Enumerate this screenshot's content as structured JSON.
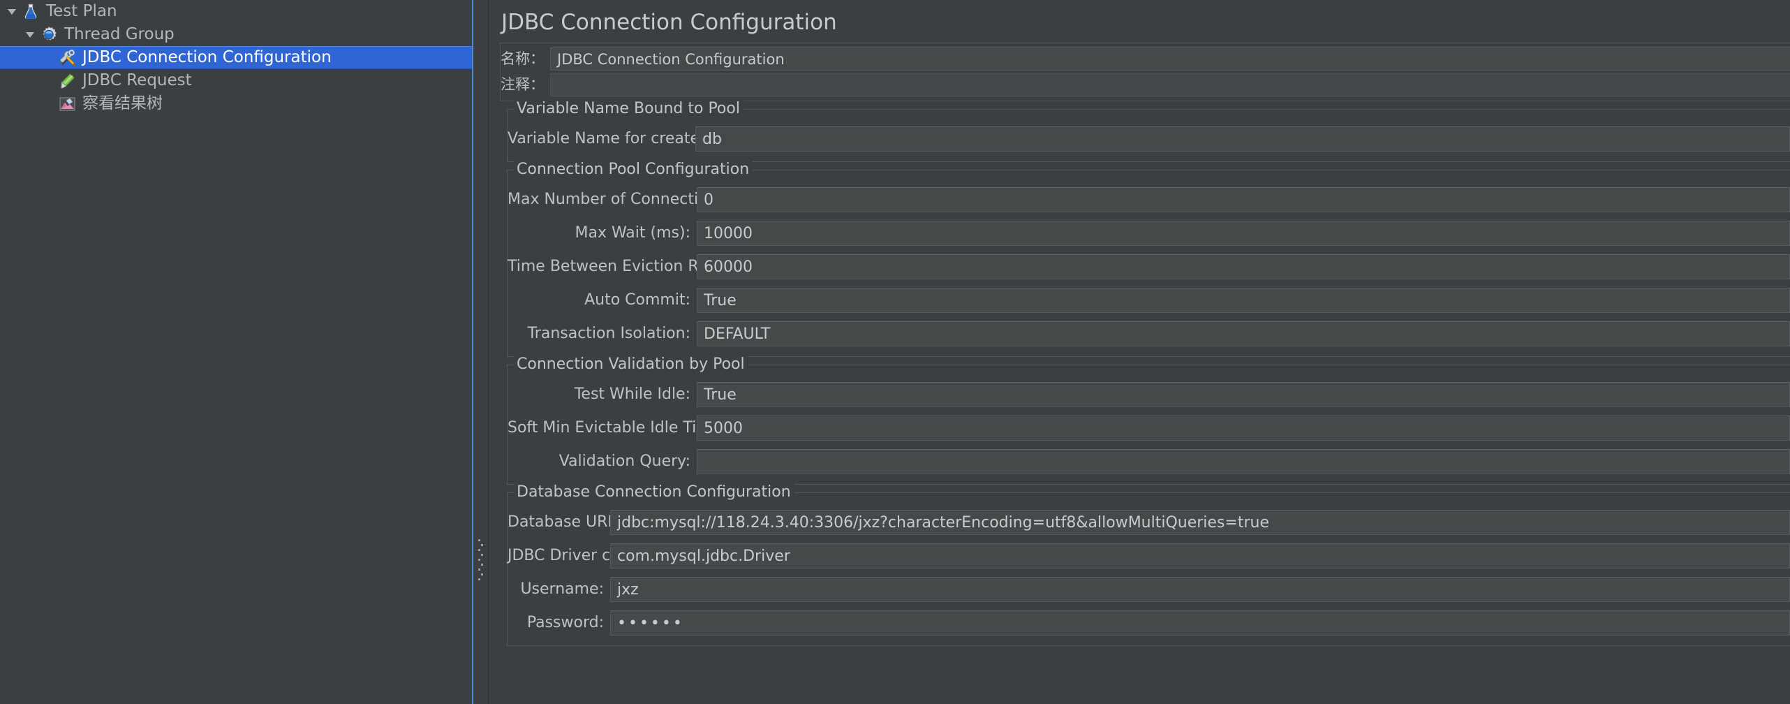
{
  "window": {
    "accent_blue": "#2f65d4",
    "bg": "#3c3f41",
    "field_bg": "#45494a"
  },
  "tree": {
    "items": [
      {
        "label": "Test Plan",
        "icon": "test-plan-icon",
        "depth": 0,
        "expanded": true,
        "selected": false
      },
      {
        "label": "Thread Group",
        "icon": "thread-group-icon",
        "depth": 1,
        "expanded": true,
        "selected": false
      },
      {
        "label": "JDBC Connection Configuration",
        "icon": "jdbc-connection-configuration-icon",
        "depth": 2,
        "expanded": null,
        "selected": true
      },
      {
        "label": "JDBC Request",
        "icon": "jdbc-request-icon",
        "depth": 2,
        "expanded": null,
        "selected": false
      },
      {
        "label": "察看结果树",
        "icon": "view-results-tree-icon",
        "depth": 2,
        "expanded": null,
        "selected": false
      }
    ]
  },
  "panel": {
    "title": "JDBC Connection Configuration",
    "meta": {
      "name_label": "名称：",
      "name_value": "JDBC Connection Configuration",
      "comment_label": "注释：",
      "comment_value": ""
    },
    "groups": [
      {
        "title": "Variable Name Bound to Pool",
        "fields": [
          {
            "label": "Variable Name for created pool:",
            "value": "db",
            "name": "variable-name-for-created-pool"
          }
        ]
      },
      {
        "title": "Connection Pool Configuration",
        "fields": [
          {
            "label": "Max Number of Connections:",
            "value": "0",
            "name": "max-number-of-connections"
          },
          {
            "label": "Max Wait (ms):",
            "value": "10000",
            "name": "max-wait-ms"
          },
          {
            "label": "Time Between Eviction Runs (ms):",
            "value": "60000",
            "name": "time-between-eviction-runs-ms"
          },
          {
            "label": "Auto Commit:",
            "value": "True",
            "name": "auto-commit"
          },
          {
            "label": "Transaction Isolation:",
            "value": "DEFAULT",
            "name": "transaction-isolation"
          }
        ]
      },
      {
        "title": "Connection Validation by Pool",
        "fields": [
          {
            "label": "Test While Idle:",
            "value": "True",
            "name": "test-while-idle"
          },
          {
            "label": "Soft Min Evictable Idle Time(ms):",
            "value": "5000",
            "name": "soft-min-evictable-idle-time-ms"
          },
          {
            "label": "Validation Query:",
            "value": "",
            "name": "validation-query"
          }
        ]
      },
      {
        "title": "Database Connection Configuration",
        "fields": [
          {
            "label": "Database URL:",
            "value": "jdbc:mysql://118.24.3.40:3306/jxz?characterEncoding=utf8&allowMultiQueries=true",
            "name": "database-url"
          },
          {
            "label": "JDBC Driver class:",
            "value": "com.mysql.jdbc.Driver",
            "name": "jdbc-driver-class"
          },
          {
            "label": "Username:",
            "value": "jxz",
            "name": "username"
          },
          {
            "label": "Password:",
            "value": "••••••",
            "name": "password"
          }
        ]
      }
    ]
  }
}
